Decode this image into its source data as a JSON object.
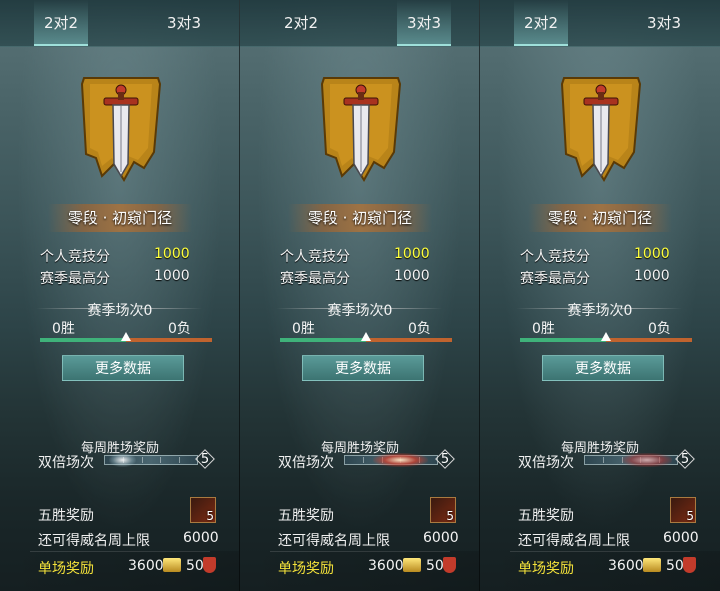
{
  "panels": [
    {
      "tabs": [
        "2对2",
        "3对3"
      ],
      "active_tab": 0,
      "rank_name": "零段 · 初窥门径",
      "personal_score_label": "个人竞技分",
      "personal_score_value": "1000",
      "season_high_label": "赛季最高分",
      "season_high_value": "1000",
      "season_matches": "赛季场次0",
      "wins": "0胜",
      "losses": "0负",
      "win_ratio": 0.5,
      "more_data": "更多数据",
      "weekly_title": "每周胜场奖励",
      "double_label": "双倍场次",
      "double_count": "5",
      "five_win_label": "五胜奖励",
      "five_win_qty": "5",
      "weekly_cap_label": "还可得威名周上限",
      "weekly_cap_value": "6000",
      "single_label": "单场奖励",
      "single_value_1": "3600",
      "single_value_2": "50"
    },
    {
      "tabs": [
        "2对2",
        "3对3"
      ],
      "active_tab": 1,
      "rank_name": "零段 · 初窥门径",
      "personal_score_label": "个人竞技分",
      "personal_score_value": "1000",
      "season_high_label": "赛季最高分",
      "season_high_value": "1000",
      "season_matches": "赛季场次0",
      "wins": "0胜",
      "losses": "0负",
      "win_ratio": 0.5,
      "more_data": "更多数据",
      "weekly_title": "每周胜场奖励",
      "double_label": "双倍场次",
      "double_count": "5",
      "five_win_label": "五胜奖励",
      "five_win_qty": "5",
      "weekly_cap_label": "还可得威名周上限",
      "weekly_cap_value": "6000",
      "single_label": "单场奖励",
      "single_value_1": "3600",
      "single_value_2": "50"
    },
    {
      "tabs": [
        "2对2",
        "3对3"
      ],
      "active_tab": 0,
      "rank_name": "零段 · 初窥门径",
      "personal_score_label": "个人竞技分",
      "personal_score_value": "1000",
      "season_high_label": "赛季最高分",
      "season_high_value": "1000",
      "season_matches": "赛季场次0",
      "wins": "0胜",
      "losses": "0负",
      "win_ratio": 0.5,
      "more_data": "更多数据",
      "weekly_title": "每周胜场奖励",
      "double_label": "双倍场次",
      "double_count": "5",
      "five_win_label": "五胜奖励",
      "five_win_qty": "5",
      "weekly_cap_label": "还可得威名周上限",
      "weekly_cap_value": "6000",
      "single_label": "单场奖励",
      "single_value_1": "3600",
      "single_value_2": "50"
    }
  ],
  "colors": {
    "score_highlight": "#ffff3a",
    "single_reward_label": "#f4e23a",
    "win_bar": "#3fb27a",
    "loss_bar": "#c0632e"
  },
  "icons": {
    "emblem": "sword-banner-icon",
    "reward_chest": "reward-chest-icon",
    "gold": "gold-ingot-icon",
    "badge": "honor-shield-icon"
  }
}
